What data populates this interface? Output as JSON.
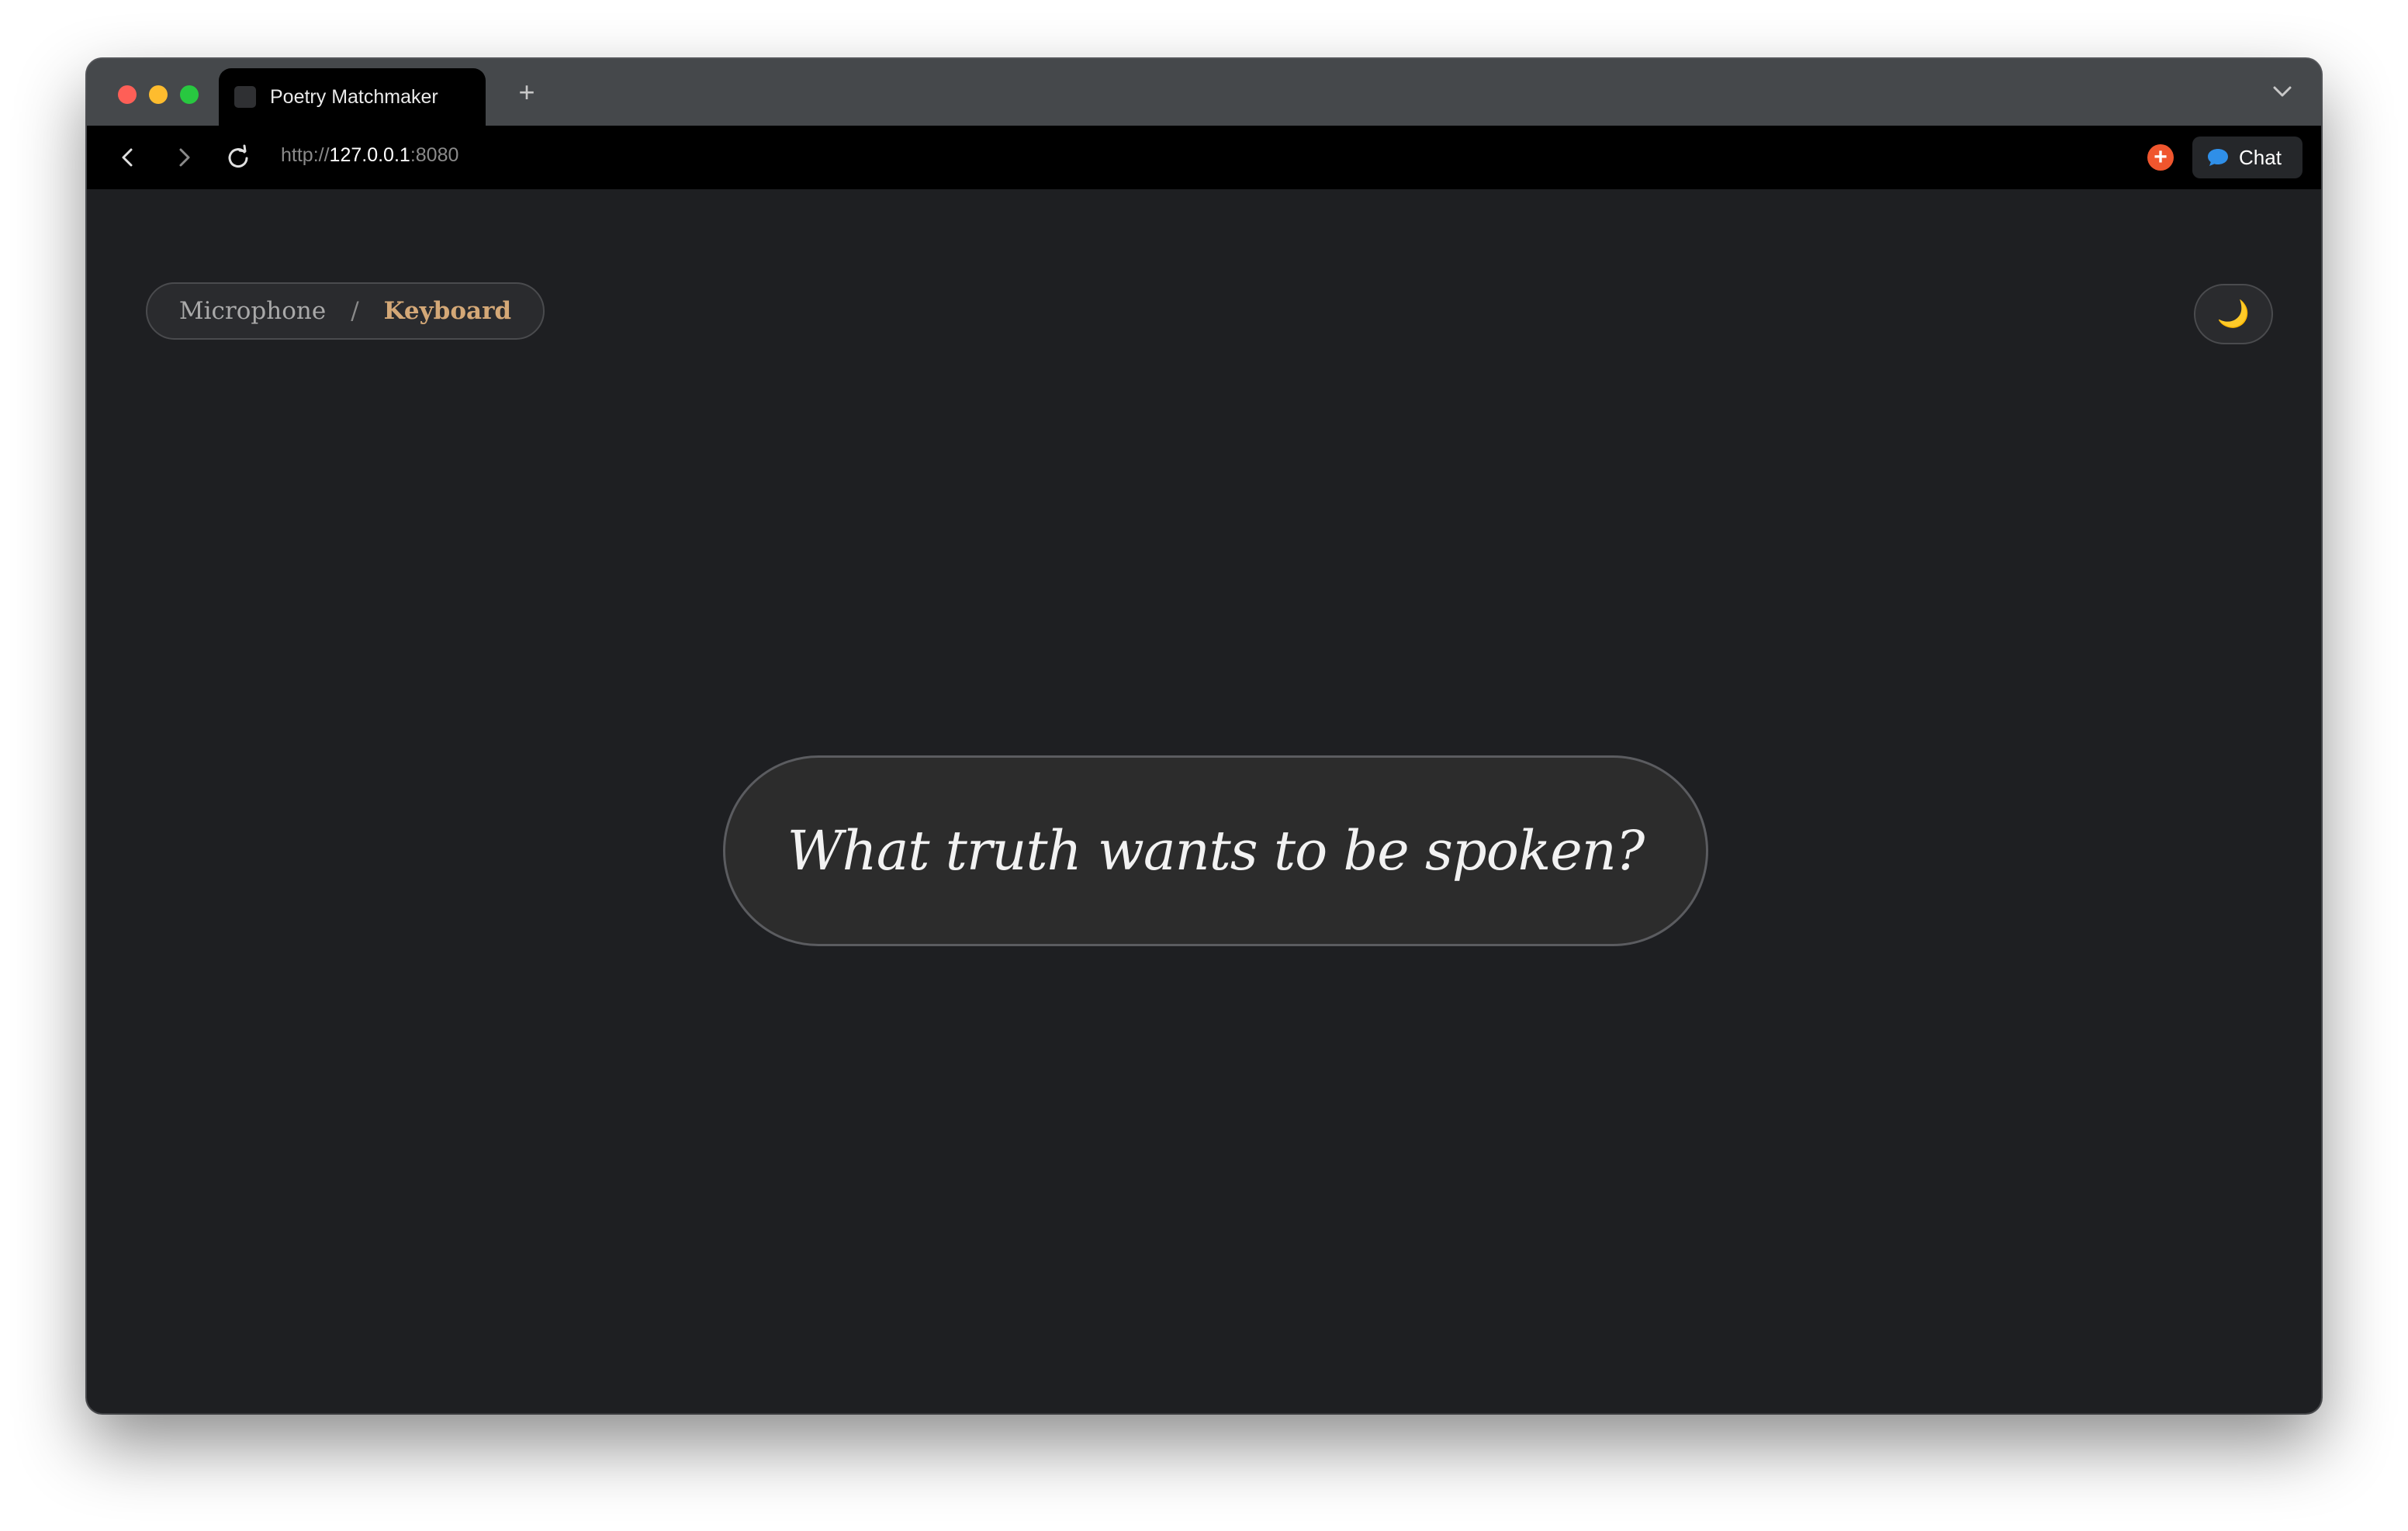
{
  "browser": {
    "tab_title": "Poetry Matchmaker",
    "new_tab_label": "+",
    "url": {
      "scheme": "http://",
      "host": "127.0.0.1",
      "port": ":8080"
    },
    "chat_label": "Chat",
    "icons": {
      "back": "chevron-left-icon",
      "forward": "chevron-right-icon",
      "reload": "reload-icon",
      "tab_menu": "chevron-down-icon",
      "extension": "plus-circle-icon",
      "chat": "chat-bubble-icon"
    }
  },
  "page": {
    "mode_toggle": {
      "microphone_label": "Microphone",
      "separator": "/",
      "keyboard_label": "Keyboard",
      "active": "Keyboard"
    },
    "theme_toggle": {
      "icon": "moon-icon",
      "glyph": "🌙"
    },
    "prompt": "What truth wants to be spoken?"
  },
  "colors": {
    "background": "#1e1f22",
    "accent": "#d4a877",
    "pill": "#2c2c2c",
    "text": "#f2f2f2"
  }
}
